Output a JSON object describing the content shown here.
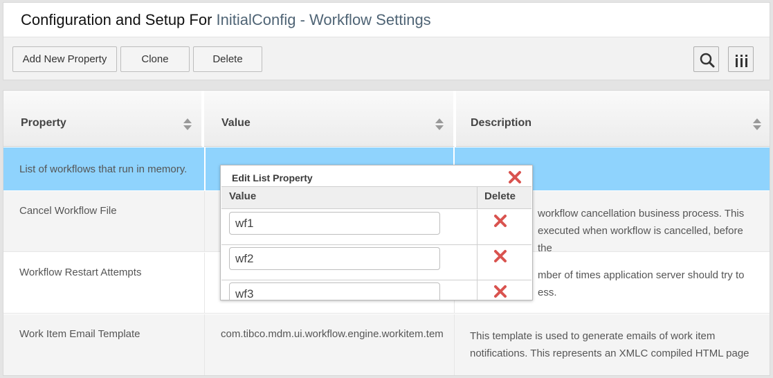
{
  "header": {
    "title_prefix": "Configuration and Setup For ",
    "title_name": "InitialConfig - Workflow Settings"
  },
  "toolbar": {
    "add_label": "Add New Property",
    "clone_label": "Clone",
    "delete_label": "Delete",
    "search_icon": "search-icon",
    "columns_icon": "columns-icon"
  },
  "grid": {
    "columns": [
      "Property",
      "Value",
      "Description"
    ],
    "rows": [
      {
        "property": "List of workflows that run in memory.",
        "value": "",
        "description": ""
      },
      {
        "property": "Cancel Workflow File",
        "value": "",
        "description": "workflow cancellation business process. This executed when workflow is cancelled, before the"
      },
      {
        "property": "Workflow Restart Attempts",
        "value": "",
        "description": "mber of times application server should try to ess."
      },
      {
        "property": "Work Item Email Template",
        "value": "com.tibco.mdm.ui.workflow.engine.workitem.tem",
        "description": "This template is used to generate emails of work item notifications. This represents an XMLC compiled HTML page"
      }
    ]
  },
  "popup": {
    "title": "Edit List Property",
    "col_value": "Value",
    "col_delete": "Delete",
    "items": [
      "wf1",
      "wf2",
      "wf3"
    ]
  },
  "colors": {
    "selected_row": "#8fd3fd",
    "delete_red": "#d9534f",
    "title_accent": "#4f6475"
  }
}
